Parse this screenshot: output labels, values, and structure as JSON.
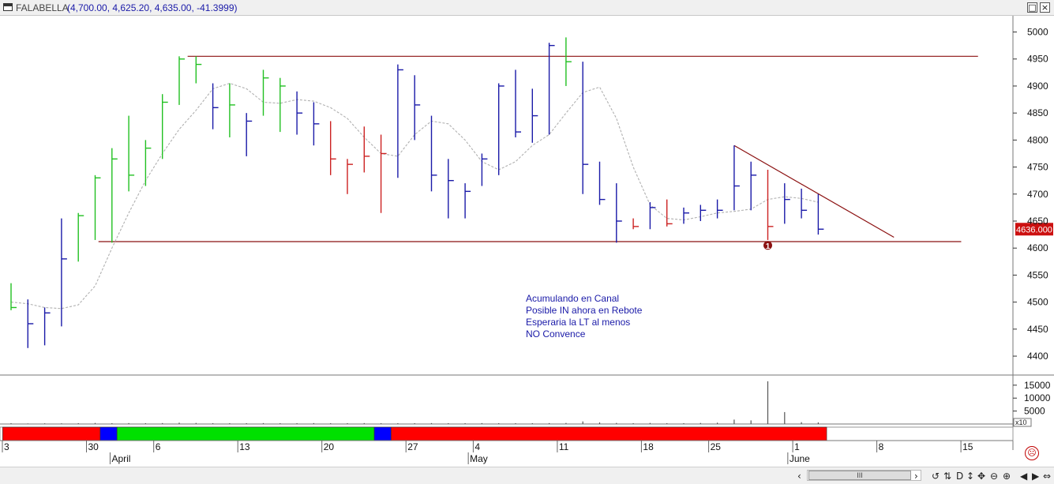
{
  "window": {
    "symbol": "FALABELLA",
    "ohlc_text": "(4,700.00, 4,625.20, 4,635.00, -41.3999)",
    "buttons": [
      "restore-button",
      "close-button"
    ]
  },
  "annotation_notes": [
    "Acumulando en Canal",
    "Posible IN ahora en Rebote",
    "Esperaria la LT al menos",
    "NO Convence"
  ],
  "signal_marker": "1",
  "last_price_tag": "4636.000",
  "scroll": {
    "thumb_label": "III"
  },
  "scroll_buttons": [
    "‹",
    "›",
    "↺",
    "⇅",
    "D",
    "↕",
    "✥",
    "⊖",
    "⊕",
    "◀",
    "▶",
    "⇔"
  ],
  "colors": {
    "up_bar": "#22c022",
    "down_bar": "#1a1aa8",
    "red_bar": "#cc2222",
    "ma_line": "#b0b0b0",
    "channel_line": "#8b1010",
    "band_red": "#ff0000",
    "band_green": "#00e000",
    "band_blue": "#0000ff",
    "note_text": "#1a1aa8",
    "marker": "#8b1010"
  },
  "chart_data": {
    "type": "ohlc",
    "price_axis": {
      "ylim": [
        4365,
        5030
      ],
      "ticks": [
        4400,
        4450,
        4500,
        4550,
        4600,
        4650,
        4700,
        4750,
        4800,
        4850,
        4900,
        4950,
        5000
      ]
    },
    "volume_axis": {
      "ylim": [
        0,
        18000
      ],
      "ticks": [
        5000,
        10000,
        15000
      ],
      "multiplier_label": "x10"
    },
    "x_axis": {
      "bar_count": 48,
      "day_labels": [
        {
          "bar": 0,
          "label": "3"
        },
        {
          "bar": 5,
          "label": "30"
        },
        {
          "bar": 9,
          "label": "6"
        },
        {
          "bar": 14,
          "label": "13"
        },
        {
          "bar": 19,
          "label": "20"
        },
        {
          "bar": 24,
          "label": "27"
        },
        {
          "bar": 28,
          "label": "4"
        },
        {
          "bar": 33,
          "label": "11"
        },
        {
          "bar": 38,
          "label": "18"
        },
        {
          "bar": 42,
          "label": "25"
        },
        {
          "bar": 47,
          "label": "1"
        },
        {
          "bar": 52,
          "label": "8"
        },
        {
          "bar": 57,
          "label": "15"
        }
      ],
      "month_labels": [
        {
          "bar": 6.5,
          "label": "April"
        },
        {
          "bar": 27.8,
          "label": "May"
        },
        {
          "bar": 46.8,
          "label": "June"
        }
      ]
    },
    "bars": [
      {
        "h": 4535,
        "l": 4485,
        "c": 4490,
        "color": "green"
      },
      {
        "h": 4505,
        "l": 4415,
        "c": 4460,
        "color": "blue"
      },
      {
        "h": 4490,
        "l": 4420,
        "c": 4480,
        "color": "blue"
      },
      {
        "h": 4655,
        "l": 4455,
        "c": 4580,
        "color": "blue"
      },
      {
        "h": 4665,
        "l": 4575,
        "c": 4660,
        "color": "green"
      },
      {
        "h": 4735,
        "l": 4615,
        "c": 4730,
        "color": "green"
      },
      {
        "h": 4785,
        "l": 4610,
        "c": 4765,
        "color": "green"
      },
      {
        "h": 4845,
        "l": 4705,
        "c": 4735,
        "color": "green"
      },
      {
        "h": 4800,
        "l": 4715,
        "c": 4785,
        "color": "green"
      },
      {
        "h": 4885,
        "l": 4765,
        "c": 4870,
        "color": "green"
      },
      {
        "h": 4955,
        "l": 4865,
        "c": 4950,
        "color": "green"
      },
      {
        "h": 4955,
        "l": 4905,
        "c": 4940,
        "color": "green"
      },
      {
        "h": 4905,
        "l": 4820,
        "c": 4860,
        "color": "blue"
      },
      {
        "h": 4905,
        "l": 4805,
        "c": 4865,
        "color": "green"
      },
      {
        "h": 4850,
        "l": 4770,
        "c": 4835,
        "color": "blue"
      },
      {
        "h": 4930,
        "l": 4845,
        "c": 4915,
        "color": "green"
      },
      {
        "h": 4915,
        "l": 4815,
        "c": 4900,
        "color": "green"
      },
      {
        "h": 4890,
        "l": 4810,
        "c": 4850,
        "color": "blue"
      },
      {
        "h": 4870,
        "l": 4790,
        "c": 4830,
        "color": "blue"
      },
      {
        "h": 4835,
        "l": 4735,
        "c": 4765,
        "color": "red"
      },
      {
        "h": 4765,
        "l": 4700,
        "c": 4755,
        "color": "red"
      },
      {
        "h": 4825,
        "l": 4740,
        "c": 4770,
        "color": "red"
      },
      {
        "h": 4810,
        "l": 4665,
        "c": 4775,
        "color": "red"
      },
      {
        "h": 4940,
        "l": 4730,
        "c": 4930,
        "color": "blue"
      },
      {
        "h": 4920,
        "l": 4800,
        "c": 4865,
        "color": "blue"
      },
      {
        "h": 4845,
        "l": 4705,
        "c": 4735,
        "color": "blue"
      },
      {
        "h": 4765,
        "l": 4655,
        "c": 4725,
        "color": "blue"
      },
      {
        "h": 4720,
        "l": 4655,
        "c": 4705,
        "color": "blue"
      },
      {
        "h": 4775,
        "l": 4715,
        "c": 4765,
        "color": "blue"
      },
      {
        "h": 4905,
        "l": 4735,
        "c": 4900,
        "color": "blue"
      },
      {
        "h": 4930,
        "l": 4805,
        "c": 4815,
        "color": "blue"
      },
      {
        "h": 4895,
        "l": 4795,
        "c": 4845,
        "color": "blue"
      },
      {
        "h": 4980,
        "l": 4810,
        "c": 4975,
        "color": "blue"
      },
      {
        "h": 4990,
        "l": 4900,
        "c": 4945,
        "color": "green"
      },
      {
        "h": 4945,
        "l": 4700,
        "c": 4755,
        "color": "blue"
      },
      {
        "h": 4760,
        "l": 4680,
        "c": 4690,
        "color": "blue"
      },
      {
        "h": 4720,
        "l": 4610,
        "c": 4650,
        "color": "blue"
      },
      {
        "h": 4655,
        "l": 4635,
        "c": 4640,
        "color": "red"
      },
      {
        "h": 4685,
        "l": 4635,
        "c": 4675,
        "color": "blue"
      },
      {
        "h": 4690,
        "l": 4640,
        "c": 4645,
        "color": "red"
      },
      {
        "h": 4675,
        "l": 4645,
        "c": 4665,
        "color": "blue"
      },
      {
        "h": 4680,
        "l": 4650,
        "c": 4670,
        "color": "blue"
      },
      {
        "h": 4690,
        "l": 4655,
        "c": 4670,
        "color": "blue"
      },
      {
        "h": 4790,
        "l": 4670,
        "c": 4715,
        "color": "blue"
      },
      {
        "h": 4760,
        "l": 4670,
        "c": 4735,
        "color": "blue"
      },
      {
        "h": 4745,
        "l": 4615,
        "c": 4640,
        "color": "red"
      },
      {
        "h": 4720,
        "l": 4645,
        "c": 4690,
        "color": "blue"
      },
      {
        "h": 4710,
        "l": 4655,
        "c": 4670,
        "color": "blue"
      },
      {
        "h": 4700,
        "l": 4625,
        "c": 4635,
        "color": "blue"
      }
    ],
    "moving_average": [
      4500,
      4497,
      4490,
      4488,
      4495,
      4530,
      4600,
      4665,
      4725,
      4775,
      4820,
      4855,
      4895,
      4905,
      4895,
      4870,
      4868,
      4875,
      4872,
      4860,
      4840,
      4805,
      4775,
      4770,
      4810,
      4835,
      4830,
      4800,
      4760,
      4745,
      4760,
      4790,
      4810,
      4850,
      4888,
      4898,
      4840,
      4750,
      4680,
      4655,
      4652,
      4658,
      4665,
      4668,
      4672,
      4690,
      4695,
      4692,
      4685
    ],
    "volume": [
      300,
      200,
      250,
      250,
      300,
      400,
      300,
      350,
      300,
      350,
      500,
      400,
      300,
      300,
      300,
      350,
      300,
      300,
      350,
      300,
      300,
      350,
      300,
      300,
      300,
      350,
      300,
      300,
      350,
      300,
      300,
      300,
      350,
      400,
      1000,
      600,
      400,
      300,
      400,
      300,
      300,
      400,
      500,
      1700,
      1400,
      16500,
      4600,
      700,
      600
    ],
    "channel_lines": [
      {
        "name": "resistance",
        "from": {
          "bar": 10.5,
          "price": 4955
        },
        "to": {
          "bar": 57.5,
          "price": 4955
        }
      },
      {
        "name": "support",
        "from": {
          "bar": 5.2,
          "price": 4612
        },
        "to": {
          "bar": 56.5,
          "price": 4612
        }
      },
      {
        "name": "trend-line",
        "from": {
          "bar": 43,
          "price": 4790
        },
        "to": {
          "bar": 52.5,
          "price": 4620
        }
      }
    ],
    "signal_marker": {
      "bar": 45,
      "price": 4605
    },
    "state_band": [
      {
        "from_bar": -0.5,
        "to_bar": 5.3,
        "color": "red"
      },
      {
        "from_bar": 5.3,
        "to_bar": 6.3,
        "color": "blue"
      },
      {
        "from_bar": 6.3,
        "to_bar": 21.6,
        "color": "green"
      },
      {
        "from_bar": 21.6,
        "to_bar": 22.6,
        "color": "blue"
      },
      {
        "from_bar": 22.6,
        "to_bar": 48.5,
        "color": "red"
      }
    ]
  }
}
